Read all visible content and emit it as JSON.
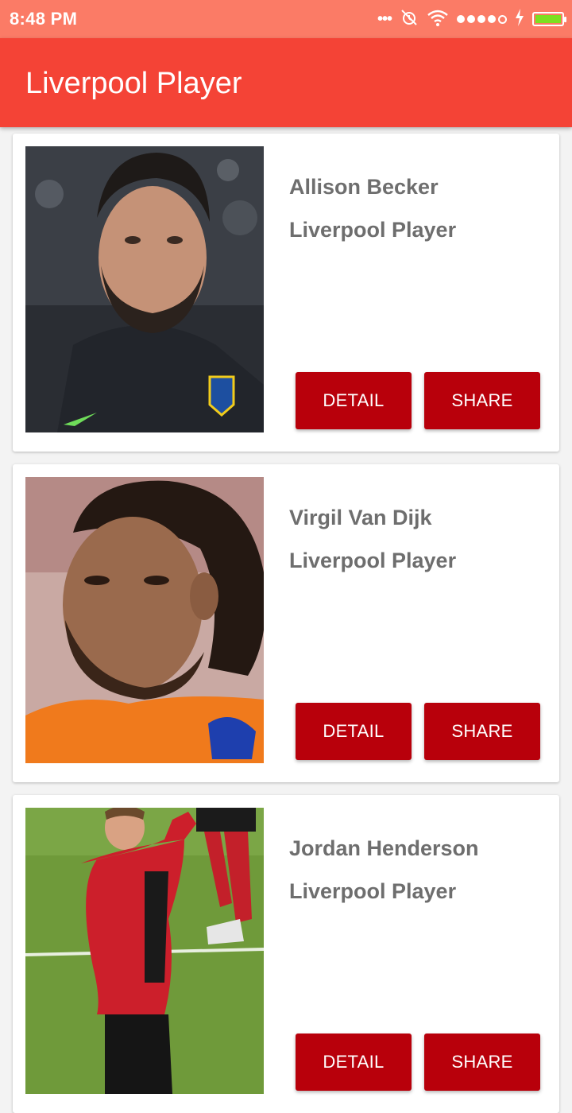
{
  "status_bar": {
    "time": "8:48 PM",
    "icons": [
      "more-dots-icon",
      "alarm-off-icon",
      "wifi-icon",
      "signal-dots-icon",
      "charging-icon",
      "battery-icon"
    ],
    "battery_color": "#7ce021"
  },
  "app_bar": {
    "title": "Liverpool Player",
    "color": "#f44336"
  },
  "players": [
    {
      "name": "Allison Becker",
      "subtitle": "Liverpool Player",
      "detail_label": "DETAIL",
      "share_label": "SHARE",
      "photo": "allison-becker-photo"
    },
    {
      "name": "Virgil Van Dijk",
      "subtitle": "Liverpool Player",
      "detail_label": "DETAIL",
      "share_label": "SHARE",
      "photo": "virgil-van-dijk-photo"
    },
    {
      "name": "Jordan Henderson",
      "subtitle": "Liverpool Player",
      "detail_label": "DETAIL",
      "share_label": "SHARE",
      "photo": "jordan-henderson-photo"
    }
  ],
  "colors": {
    "status_bar": "#fb7b66",
    "button": "#b8000b",
    "text": "#6e6e6e"
  }
}
